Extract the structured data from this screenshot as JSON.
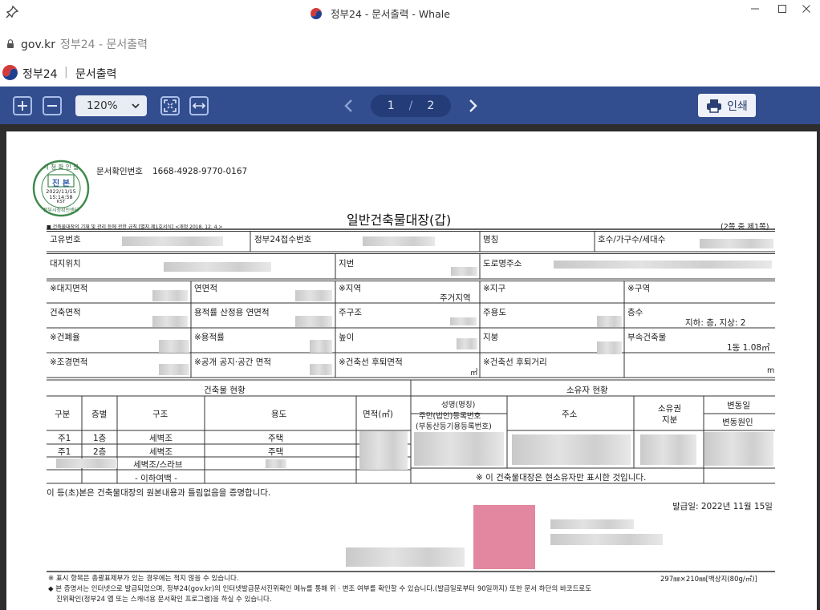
{
  "window": {
    "title": "정부24 - 문서출력 - Whale",
    "minimize_icon": "minimize-icon",
    "maximize_icon": "maximize-icon",
    "close_icon": "close-icon"
  },
  "address": {
    "domain": "gov.kr",
    "page_title": "정부24 - 문서출력"
  },
  "app_header": {
    "brand": "정부24",
    "separator": "|",
    "page": "문서출력"
  },
  "toolbar": {
    "zoom_value": "120%",
    "page_current": "1",
    "page_sep": "/",
    "page_total": "2",
    "print_label": "인쇄"
  },
  "colors": {
    "toolbar_bg": "#334e8f",
    "pager_bg": "#243d78",
    "doc_bg": "#2d2d2d",
    "stamp_green": "#3e8a4e",
    "seal_red": "#e2879f"
  },
  "document": {
    "stamp": {
      "top_text": "시 청 확 인 필",
      "label": "진 본",
      "date": "2022/11/15",
      "time": "15:14:58",
      "tz": "KST",
      "bottom_text": "정부시청확인센터"
    },
    "doc_number_label": "문서확인번호",
    "doc_number": "1668-4928-9770-0167",
    "law_note": "■ 건축물대장의 기재 및 관리 등에 관한 규칙 [별지 제1호서식] <개정 2018. 12. 4.>",
    "title": "일반건축물대장(갑)",
    "page_count": "(2쪽 중 제1쪽)",
    "header_row": {
      "unique_no": "고유번호",
      "receipt_no": "정부24접수번호",
      "name": "명칭",
      "unit": "호수/가구수/세대수"
    },
    "location_row": {
      "site": "대지위치",
      "lot": "지번",
      "road_address": "도로명주소"
    },
    "rows": [
      {
        "c1": "※대지면적",
        "c2": "연면적",
        "c3": "※지역",
        "c3_value": "주거지역",
        "c4": "※지구",
        "c5": "※구역"
      },
      {
        "c1": "건축면적",
        "c2": "용적률 산정용 연면적",
        "c3": "주구조",
        "c4": "주용도",
        "c5": "층수",
        "c5_value": "지하: 층, 지상: 2"
      },
      {
        "c1": "※건폐율",
        "c2": "※용적률",
        "c3": "높이",
        "c4": "지붕",
        "c5": "부속건축물",
        "c5_value": "1동 1.08㎡"
      },
      {
        "c1": "※조경면적",
        "c2": "※공개 공지·공간 면적",
        "c3": "※건축선 후퇴면적",
        "c3_unit": "㎡",
        "c4": "※건축선 후퇴거리",
        "c4_unit": "m"
      }
    ],
    "building_status": {
      "section_title": "건축물 현황",
      "headers": {
        "type": "구분",
        "floor": "층별",
        "structure": "구조",
        "use": "용도",
        "area": "면적(㎡)"
      },
      "rows": [
        {
          "type": "주1",
          "floor": "1층",
          "structure": "세벽조",
          "use": "주택"
        },
        {
          "type": "주1",
          "floor": "2층",
          "structure": "세벽조",
          "use": "주택"
        },
        {
          "type": "",
          "floor": "",
          "structure": "세벽조/스라브",
          "use": ""
        }
      ],
      "end_marker": "- 이하여백 -"
    },
    "owner_status": {
      "section_title": "소유자 현황",
      "name_header": "성명(명칭)",
      "id_header_1": "주민(법인)등록번호",
      "id_header_2": "(부동산등기용등록번호)",
      "address_header": "주소",
      "share_header_1": "소유권",
      "share_header_2": "지분",
      "change_date_header": "변동일",
      "change_reason_header": "변동원인",
      "note": "※ 이 건축물대장은 현소유자만 표시한 것입니다."
    },
    "certification": "이 등(초)본은 건축물대장의 원본내용과 틀림없음을 증명합니다.",
    "issue_date": "발급일:  2022년  11월  15일",
    "footer_note_1": "※ 표시 항목은 총괄표제부가 있는 경우에는 적지 않을 수 있습니다.",
    "paper_size": "297㎜×210㎜[백상지(80g/㎡)]",
    "footer_note_2": "◆ 본 증명서는 인터넷으로 발급되었으며, 정부24(gov.kr)의 인터넷발급문서진위확인 메뉴를 통해 위 · 변조 여부를 확인할 수 있습니다.(발급일로부터 90일까지) 또한 문서 하단의 바코드로도",
    "footer_note_3": "진위확인(정부24 앱 또는 스캐너용 문서확인 프로그램)을 하실 수 있습니다."
  }
}
